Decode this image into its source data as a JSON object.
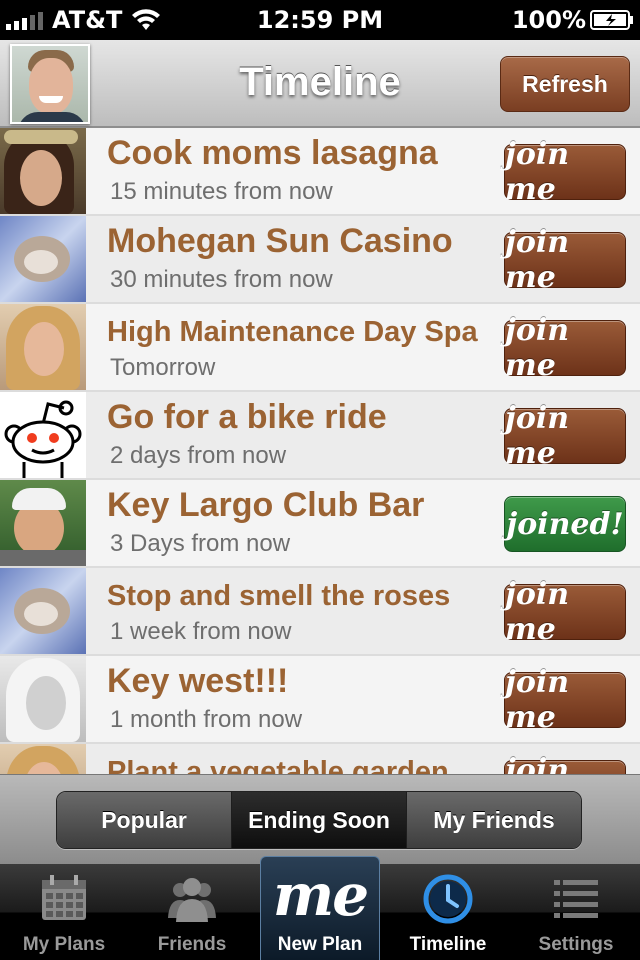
{
  "status_bar": {
    "carrier": "AT&T",
    "time": "12:59 PM",
    "battery": "100%"
  },
  "header": {
    "title": "Timeline",
    "refresh_label": "Refresh"
  },
  "plans": [
    {
      "title": "Cook moms lasagna",
      "when": "15 minutes from now",
      "action": "join me",
      "joined": false
    },
    {
      "title": "Mohegan Sun Casino",
      "when": "30 minutes from now",
      "action": "join me",
      "joined": false
    },
    {
      "title": "High Maintenance Day Spa",
      "when": "Tomorrow",
      "action": "join me",
      "joined": false
    },
    {
      "title": "Go for a bike ride",
      "when": "2 days from now",
      "action": "join me",
      "joined": false
    },
    {
      "title": "Key Largo Club Bar",
      "when": "3 Days from now",
      "action": "joined!",
      "joined": true
    },
    {
      "title": "Stop and smell the roses",
      "when": "1 week from now",
      "action": "join me",
      "joined": false
    },
    {
      "title": "Key west!!!",
      "when": "1 month from now",
      "action": "join me",
      "joined": false
    },
    {
      "title": "Plant a vegetable garden",
      "when": "",
      "action": "join me",
      "joined": false
    }
  ],
  "filter": {
    "options": [
      "Popular",
      "Ending Soon",
      "My Friends"
    ],
    "selected": "Ending Soon"
  },
  "tabs": [
    {
      "label": "My Plans",
      "icon": "calendar-icon"
    },
    {
      "label": "Friends",
      "icon": "friends-icon"
    },
    {
      "label": "New Plan",
      "icon": "me-logo-icon"
    },
    {
      "label": "Timeline",
      "icon": "clock-icon",
      "selected": true
    },
    {
      "label": "Settings",
      "icon": "list-icon"
    }
  ],
  "colors": {
    "title_brown": "#9b6333",
    "join_button": "#7a3e22",
    "joined_button": "#2c8039"
  }
}
